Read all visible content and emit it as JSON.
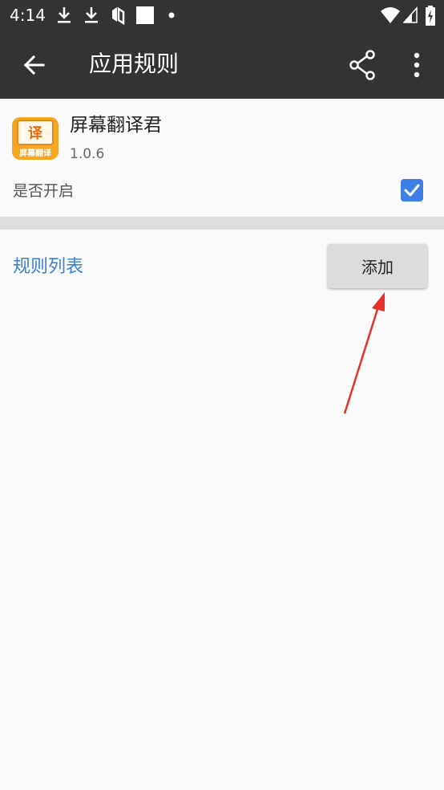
{
  "status_bar": {
    "time": "4:14",
    "left_icons": [
      "download-icon",
      "download-icon",
      "sync-icon",
      "square-icon",
      "dot-icon"
    ],
    "right_icons": [
      "wifi-icon",
      "signal-icon",
      "battery-charging-icon"
    ]
  },
  "app_bar": {
    "title": "应用规则",
    "background": "#333333",
    "icons": [
      "back-arrow-icon",
      "share-icon",
      "more-vert-icon"
    ]
  },
  "app_info": {
    "name": "屏幕翻译君",
    "version": "1.0.6",
    "icon_glyph": "译",
    "icon_caption": "屏幕翻译",
    "icon_color": "#f5a623"
  },
  "settings": {
    "enable_label": "是否开启",
    "enabled": true,
    "checkbox_color": "#3d7fe6"
  },
  "rules": {
    "title": "规则列表",
    "title_color": "#3b80d6",
    "add_label": "添加"
  },
  "annotation": {
    "type": "red-arrow",
    "color": "#e8312a",
    "points_to": "add-button"
  }
}
